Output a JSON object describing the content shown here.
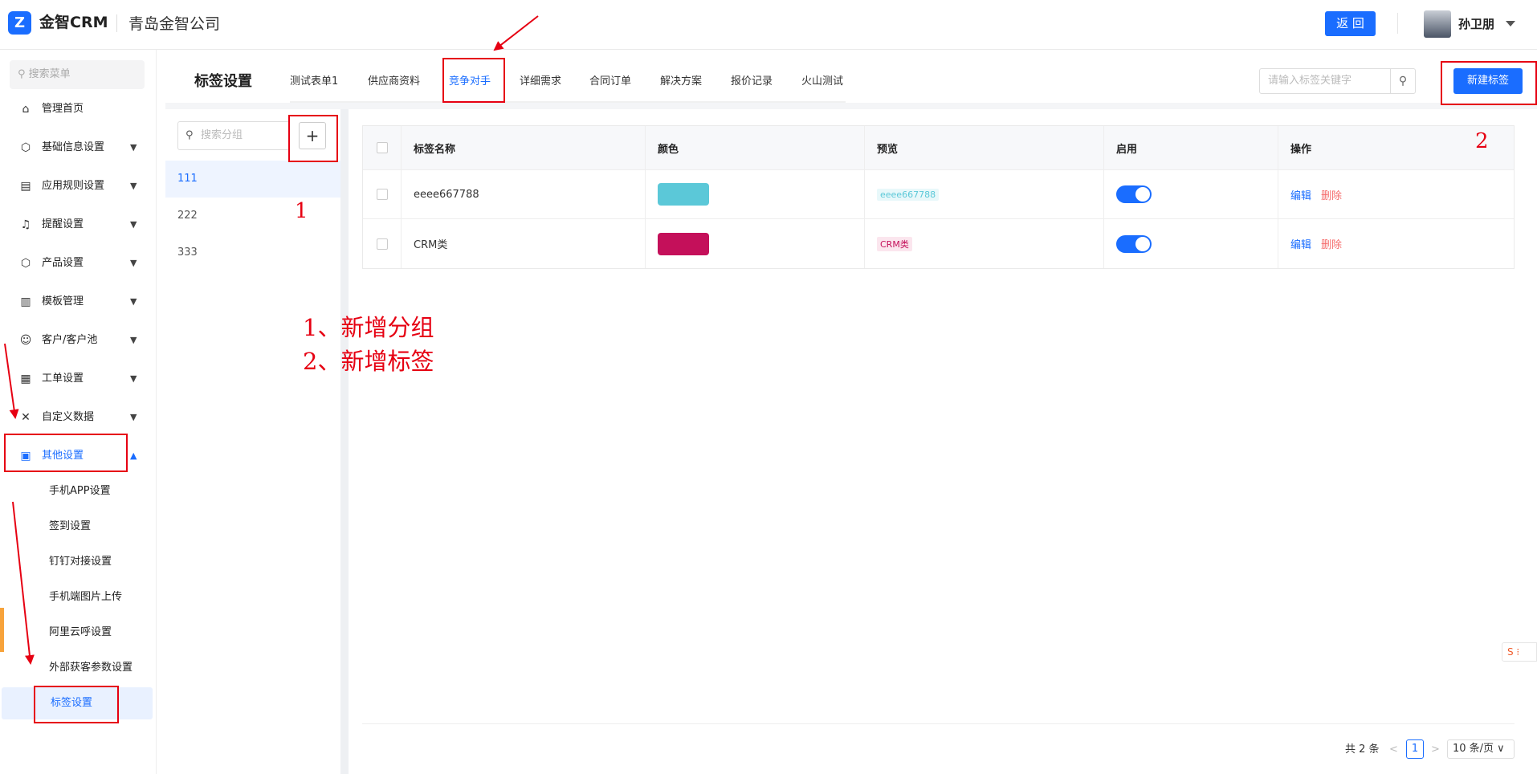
{
  "header": {
    "logo_icon": "Z",
    "app_name": "金智CRM",
    "company": "青岛金智公司",
    "back_label": "返 回",
    "user_name": "孙卫朋"
  },
  "sidebar": {
    "search_placeholder": "搜索菜单",
    "items": [
      {
        "label": "管理首页",
        "icon": "home-icon"
      },
      {
        "label": "基础信息设置",
        "icon": "cube-icon"
      },
      {
        "label": "应用规则设置",
        "icon": "document-icon"
      },
      {
        "label": "提醒设置",
        "icon": "bell-icon"
      },
      {
        "label": "产品设置",
        "icon": "cube-icon"
      },
      {
        "label": "模板管理",
        "icon": "template-icon"
      },
      {
        "label": "客户/客户池",
        "icon": "users-icon"
      },
      {
        "label": "工单设置",
        "icon": "form-icon"
      },
      {
        "label": "自定义数据",
        "icon": "tools-icon"
      },
      {
        "label": "其他设置",
        "icon": "grid-icon"
      }
    ],
    "submenu": [
      "手机APP设置",
      "签到设置",
      "钉钉对接设置",
      "手机端图片上传",
      "阿里云呼设置",
      "外部获客参数设置",
      "标签设置"
    ]
  },
  "page": {
    "title": "标签设置",
    "tabs": [
      "测试表单1",
      "供应商资料",
      "竞争对手",
      "详细需求",
      "合同订单",
      "解决方案",
      "报价记录",
      "火山测试"
    ],
    "active_tab": "竞争对手",
    "tag_search_placeholder": "请输入标签关键字",
    "new_tag_label": "新建标签"
  },
  "groups": {
    "search_placeholder": "搜索分组",
    "add_label": "+",
    "items": [
      "111",
      "222",
      "333"
    ],
    "selected": "111"
  },
  "table": {
    "headers": [
      "标签名称",
      "颜色",
      "预览",
      "启用",
      "操作"
    ],
    "rows": [
      {
        "name": "eeee667788",
        "color": "#5bc8d8",
        "preview": "eeee667788",
        "preview_color": "#5bc8d8",
        "preview_bg": "#e8f8fa",
        "enabled": true,
        "edit": "编辑",
        "delete": "删除"
      },
      {
        "name": "CRM类",
        "color": "#c4105a",
        "preview": "CRM类",
        "preview_color": "#c4105a",
        "preview_bg": "#fbe6ee",
        "enabled": true,
        "edit": "编辑",
        "delete": "删除"
      }
    ]
  },
  "pager": {
    "total": "共 2 条",
    "prev": "<",
    "page": "1",
    "next": ">",
    "size": "10 条/页 ∨"
  },
  "annotations": {
    "num1": "1",
    "num2": "2",
    "line1": "1、新增分组",
    "line2": "2、新增标签"
  },
  "widgets": {
    "side_widget": "S ⁝"
  },
  "colors": {
    "accent": "#1a6dff",
    "annotation": "#e60012",
    "danger": "#f56c6c"
  }
}
